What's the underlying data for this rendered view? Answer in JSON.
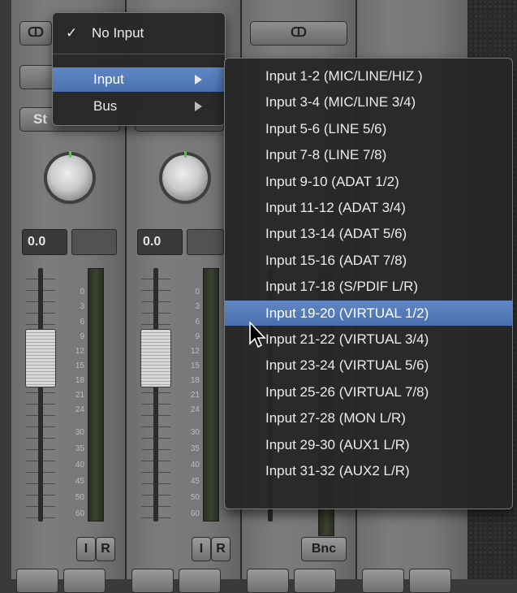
{
  "strips": [
    {
      "value": "0.0",
      "io": [
        "I",
        "R"
      ]
    },
    {
      "value": "0.0",
      "io": [
        "I",
        "R"
      ]
    },
    {
      "bounce": "Bnc"
    }
  ],
  "partial_label": "St",
  "link_icon": "link-circles-icon",
  "meter_scale": [
    "0",
    "3",
    "6",
    "9",
    "12",
    "15",
    "18",
    "21",
    "24",
    "30",
    "35",
    "40",
    "45",
    "50",
    "60"
  ],
  "input_menu": {
    "no_input": "No Input",
    "check": "✓",
    "input": "Input",
    "bus": "Bus"
  },
  "submenu": {
    "items": [
      "Input 1-2  (MIC/LINE/HIZ )",
      "Input 3-4  (MIC/LINE 3/4)",
      "Input 5-6  (LINE 5/6)",
      "Input 7-8  (LINE 7/8)",
      "Input 9-10  (ADAT 1/2)",
      "Input 11-12  (ADAT 3/4)",
      "Input 13-14  (ADAT 5/6)",
      "Input 15-16  (ADAT 7/8)",
      "Input 17-18  (S/PDIF L/R)",
      "Input 19-20  (VIRTUAL 1/2)",
      "Input 21-22  (VIRTUAL 3/4)",
      "Input 23-24  (VIRTUAL 5/6)",
      "Input 25-26  (VIRTUAL 7/8)",
      "Input 27-28  (MON L/R)",
      "Input 29-30  (AUX1 L/R)",
      "Input 31-32  (AUX2 L/R)"
    ],
    "highlighted_index": 9
  },
  "colors": {
    "accent": "#4a70b0",
    "knob_marker": "#41d14a"
  }
}
